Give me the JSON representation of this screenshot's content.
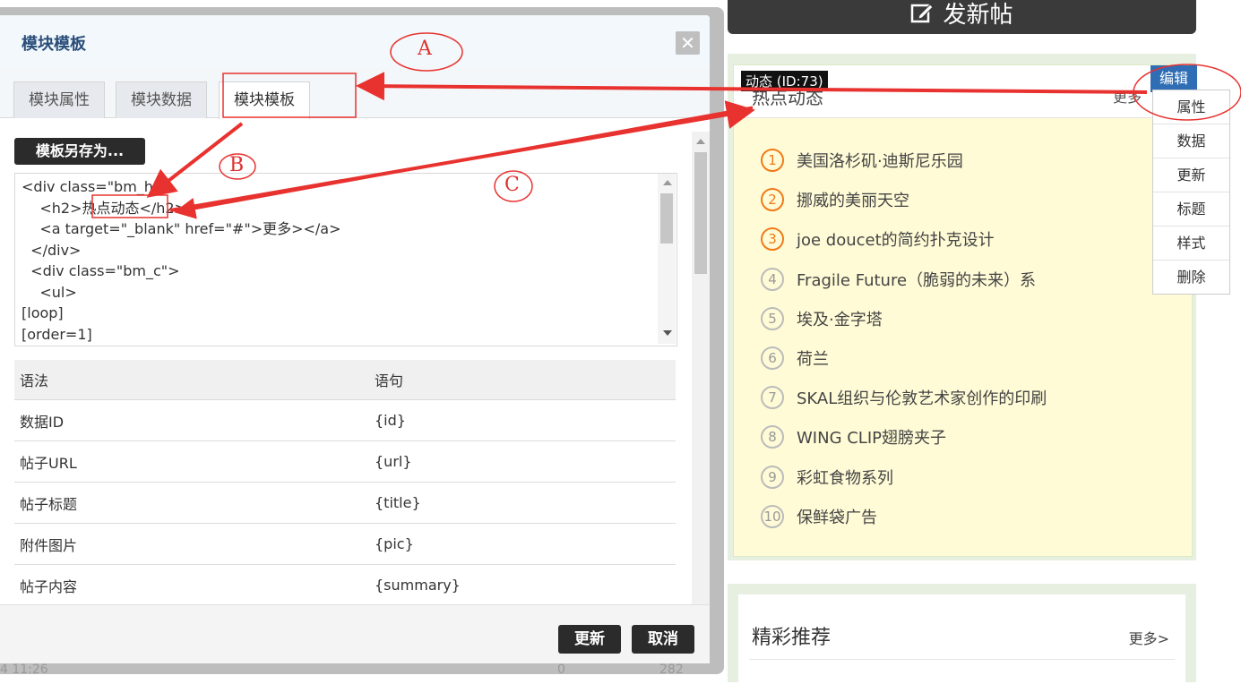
{
  "background_page": {
    "new_post_label": "发新帖",
    "hot_block": {
      "badge": "动态 (ID:73)",
      "title": "热点动态",
      "more": "更多",
      "edit": "编辑",
      "items": [
        {
          "rank": "1",
          "text": "美国洛杉矶·迪斯尼乐园"
        },
        {
          "rank": "2",
          "text": "挪威的美丽天空"
        },
        {
          "rank": "3",
          "text": "joe doucet的简约扑克设计"
        },
        {
          "rank": "4",
          "text": "Fragile Future（脆弱的未来）系"
        },
        {
          "rank": "5",
          "text": "埃及·金字塔"
        },
        {
          "rank": "6",
          "text": "荷兰"
        },
        {
          "rank": "7",
          "text": "SKAL组织与伦敦艺术家创作的印刷"
        },
        {
          "rank": "8",
          "text": "WING CLIP翅膀夹子"
        },
        {
          "rank": "9",
          "text": "彩虹食物系列"
        },
        {
          "rank": "10",
          "text": "保鲜袋广告"
        }
      ]
    },
    "context_menu": [
      "属性",
      "数据",
      "更新",
      "标题",
      "样式",
      "删除"
    ],
    "recommend_block": {
      "title": "精彩推荐",
      "more": "更多>"
    },
    "status_left": "4 11:26",
    "status_count1": "0",
    "status_count2": "282"
  },
  "dialog": {
    "title": "模块模板",
    "close": "✕",
    "tabs": [
      "模块属性",
      "模块数据",
      "模块模板"
    ],
    "active_tab": 2,
    "save_as": "模板另存为...",
    "code_lines": [
      "<div class=\"bm_h\">",
      "    <h2>热点动态</h2>",
      "    <a target=\"_blank\" href=\"#\">更多></a>",
      "  </div>",
      "  <div class=\"bm_c\">",
      "    <ul>",
      "[loop]",
      "[order=1]"
    ],
    "table_headers": [
      "语法",
      "语句"
    ],
    "table_rows": [
      {
        "name": "数据ID",
        "code": "{id}"
      },
      {
        "name": "帖子URL",
        "code": "{url}"
      },
      {
        "name": "帖子标题",
        "code": "{title}"
      },
      {
        "name": "附件图片",
        "code": "{pic}"
      },
      {
        "name": "帖子内容",
        "code": "{summary}"
      }
    ],
    "update_btn": "更新",
    "cancel_btn": "取消"
  },
  "annotations": {
    "a": "A",
    "b": "B",
    "c": "C",
    "color": "#e8322f"
  }
}
